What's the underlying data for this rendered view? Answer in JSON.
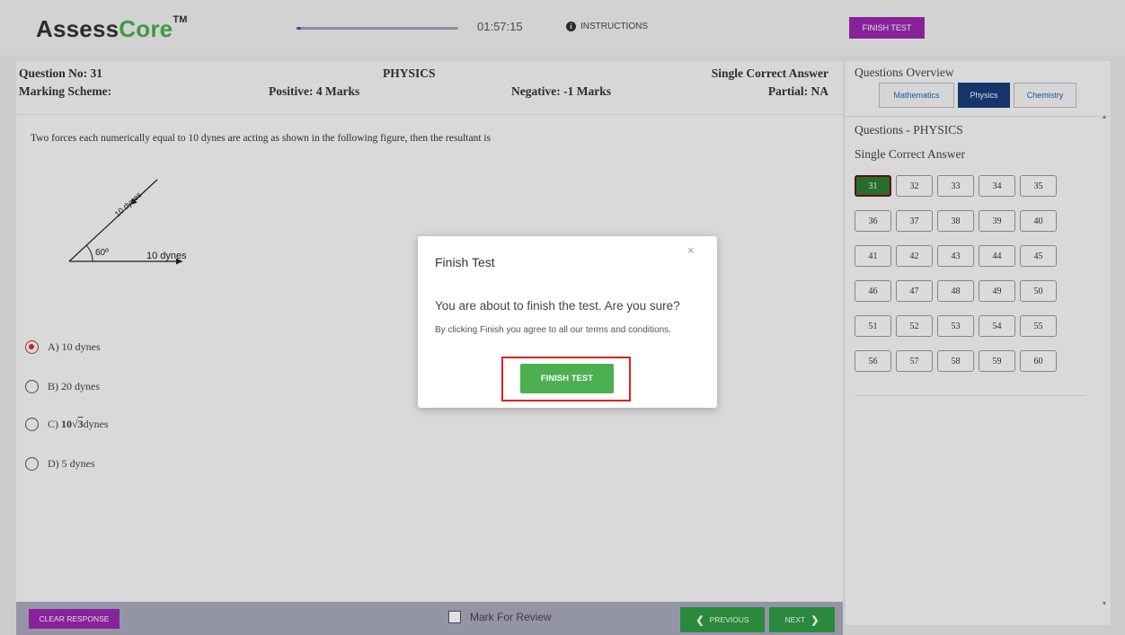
{
  "header": {
    "logo_main": "Assess",
    "logo_accent": "Core",
    "logo_tm": "TM",
    "progress_fraction": 0.03,
    "timer": "01:57:15",
    "instructions_label": "INSTRUCTIONS",
    "finish_label": "FINISH TEST"
  },
  "question_header": {
    "number": "Question No: 31",
    "subject": "PHYSICS",
    "type": "Single Correct Answer",
    "marking_label": "Marking Scheme:",
    "positive": "Positive: 4 Marks",
    "negative": "Negative: -1 Marks",
    "partial": "Partial: NA"
  },
  "question": {
    "text": "Two forces each numerically equal to 10 dynes are acting as shown in the following figure, then the resultant is",
    "figure": {
      "force_label_a": "10 dynes",
      "force_label_b": "10 dynes",
      "angle_label": "60º"
    },
    "options": [
      {
        "label": "A) 10 dynes",
        "selected": true
      },
      {
        "label": "B) 20 dynes",
        "selected": false
      },
      {
        "prefix": "C) ",
        "coef": "10",
        "radical": "3",
        "unit": "dynes",
        "selected": false
      },
      {
        "label": "D) 5 dynes",
        "selected": false
      }
    ]
  },
  "bottom": {
    "clear_label": "CLEAR RESPONSE",
    "mark_review_label": "Mark For Review",
    "previous_label": "PREVIOUS",
    "next_label": "NEXT"
  },
  "sidebar": {
    "title": "Questions Overview",
    "tabs": [
      "Mathematics",
      "Physics",
      "Chemistry"
    ],
    "active_tab": "Physics",
    "section_title": "Questions - PHYSICS",
    "section_subtitle": "Single Correct Answer",
    "questions": [
      "31",
      "32",
      "33",
      "34",
      "35",
      "36",
      "37",
      "38",
      "39",
      "40",
      "41",
      "42",
      "43",
      "44",
      "45",
      "46",
      "47",
      "48",
      "49",
      "50",
      "51",
      "52",
      "53",
      "54",
      "55",
      "56",
      "57",
      "58",
      "59",
      "60"
    ],
    "current_question": "31"
  },
  "modal": {
    "title": "Finish Test",
    "close_symbol": "×",
    "message": "You are about to finish the test. Are you sure?",
    "note": "By clicking Finish you agree to all our terms and conditions.",
    "button_label": "FINISH TEST"
  },
  "colors": {
    "purple": "#9c27b0",
    "green": "#4caf50",
    "dark_green": "#2e9e43",
    "navy": "#1a3d7c",
    "alert_red": "#e02020"
  }
}
